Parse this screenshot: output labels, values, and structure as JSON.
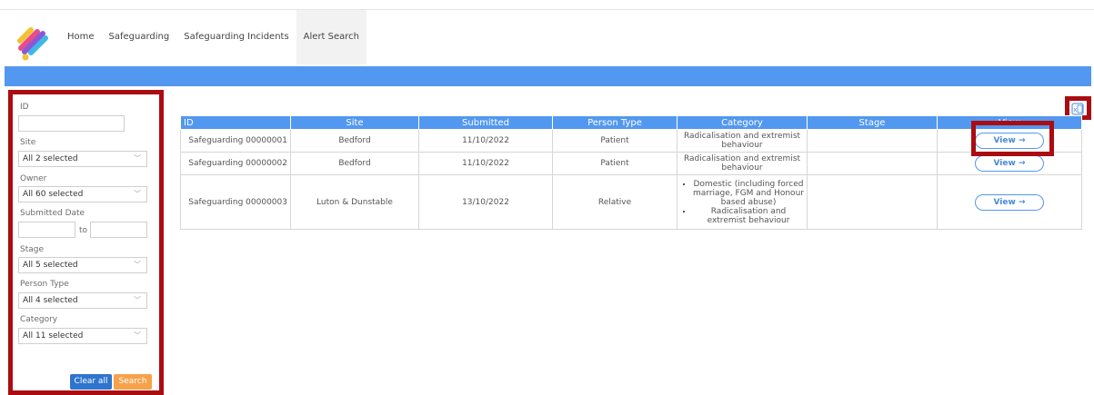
{
  "nav": {
    "items": [
      {
        "label": "Home",
        "active": false
      },
      {
        "label": "Safeguarding",
        "active": false
      },
      {
        "label": "Safeguarding Incidents",
        "active": false
      },
      {
        "label": "Alert Search",
        "active": true
      }
    ]
  },
  "filters": {
    "id_label": "ID",
    "id_value": "",
    "site_label": "Site",
    "site_value": "All 2 selected",
    "owner_label": "Owner",
    "owner_value": "All 60 selected",
    "submitted_date_label": "Submitted Date",
    "to_label": "to",
    "stage_label": "Stage",
    "stage_value": "All 5 selected",
    "person_type_label": "Person Type",
    "person_type_value": "All 4 selected",
    "category_label": "Category",
    "category_value": "All 11 selected",
    "clear_label": "Clear all",
    "search_label": "Search"
  },
  "table": {
    "headers": [
      "ID",
      "Site",
      "Submitted",
      "Person Type",
      "Category",
      "Stage",
      "View"
    ],
    "rows": [
      {
        "id": "Safeguarding 00000001",
        "site": "Bedford",
        "submitted": "11/10/2022",
        "person_type": "Patient",
        "category": "Radicalisation and extremist behaviour",
        "stage": "",
        "view": "View →"
      },
      {
        "id": "Safeguarding 00000002",
        "site": "Bedford",
        "submitted": "11/10/2022",
        "person_type": "Patient",
        "category": "Radicalisation and extremist behaviour",
        "stage": "",
        "view": "View →"
      },
      {
        "id": "Safeguarding 00000003",
        "site": "Luton & Dunstable",
        "submitted": "13/10/2022",
        "person_type": "Relative",
        "categories": [
          "Domestic (including forced marriage, FGM and Honour based abuse)",
          "Radicalisation and extremist behaviour"
        ],
        "stage": "",
        "view": "View →"
      }
    ]
  },
  "colors": {
    "accent_blue": "#5398f0",
    "highlight_red": "#aa0c12",
    "clear_button": "#2f75cf",
    "search_button": "#f7a24a"
  }
}
